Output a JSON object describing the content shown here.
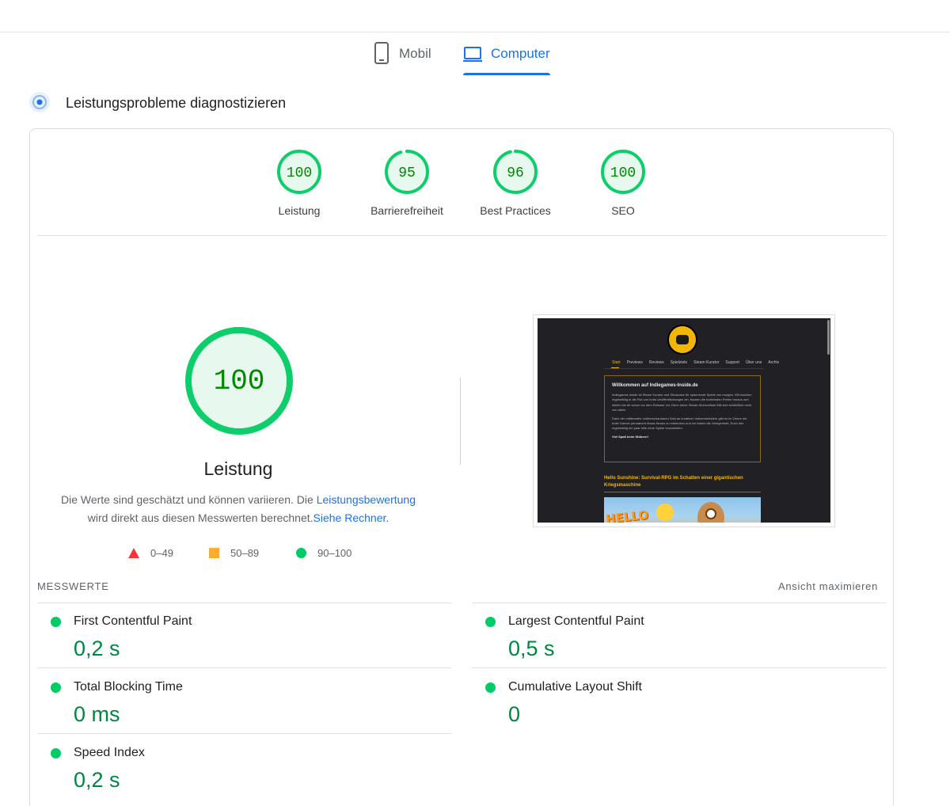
{
  "tabs": {
    "mobile": "Mobil",
    "desktop": "Computer"
  },
  "diagnose_title": "Leistungsprobleme diagnostizieren",
  "scores": [
    {
      "value": "100",
      "score": 100,
      "label": "Leistung"
    },
    {
      "value": "95",
      "score": 95,
      "label": "Barrierefreiheit"
    },
    {
      "value": "96",
      "score": 96,
      "label": "Best Practices"
    },
    {
      "value": "100",
      "score": 100,
      "label": "SEO"
    }
  ],
  "performance": {
    "value": "100",
    "score": 100,
    "title": "Leistung",
    "desc_1": "Die Werte sind geschätzt und können variieren. Die ",
    "desc_link_1": "Leistungsbewertung",
    "desc_2": " wird direkt aus diesen Messwerten berechnet.",
    "desc_link_2": "Siehe Rechner."
  },
  "legend": {
    "poor": "0–49",
    "average": "50–89",
    "good": "90–100"
  },
  "screenshot": {
    "nav": [
      "Start",
      "Previews",
      "Reviews",
      "Spielziele",
      "Steam Kurator",
      "Support",
      "Über uns",
      "Archiv"
    ],
    "box_title": "Willkommen auf Indiegames-Inside.de",
    "box_p1": "Indiegames Inside ist Steam Kurator und Showcase für spannende Spiele von morgen. Wir tauchen regelmäßig in die Flut von Indie-Veröffentlichungen ein, fischen die funkelnden Perlen heraus und stellen sie dir schon vor dem Release vor. Denn deine Steam-Wunschliste füllt sich schließlich nicht von allein.",
    "box_p2": "Dank der mittlerweile unüberschaubaren Zahl an kreativen Indieentwicklern gibt es im Genre der Indie Games permanent etwas Neues zu entdecken und wir haben die Gelegenheit, Euch hier regelmäßig ein paar tolle neue Spiele vorzustellen.",
    "box_strong": "Viel Spaß beim Stöbern!",
    "post_title": "Hello Sunshine: Survival-RPG im Schatten einer gigantischen Kriegsmaschine",
    "post_image_text": "HELLO"
  },
  "metrics": {
    "header": "Messwerte",
    "expand": "Ansicht maximieren",
    "items": [
      {
        "title": "First Contentful Paint",
        "value": "0,2 s"
      },
      {
        "title": "Largest Contentful Paint",
        "value": "0,5 s"
      },
      {
        "title": "Total Blocking Time",
        "value": "0 ms"
      },
      {
        "title": "Cumulative Layout Shift",
        "value": "0"
      },
      {
        "title": "Speed Index",
        "value": "0,2 s"
      }
    ]
  },
  "colors": {
    "good": "#0cce6b",
    "good_text": "#008800",
    "average": "#ffa400",
    "poor": "#ff3333",
    "accent": "#1a73e8"
  }
}
